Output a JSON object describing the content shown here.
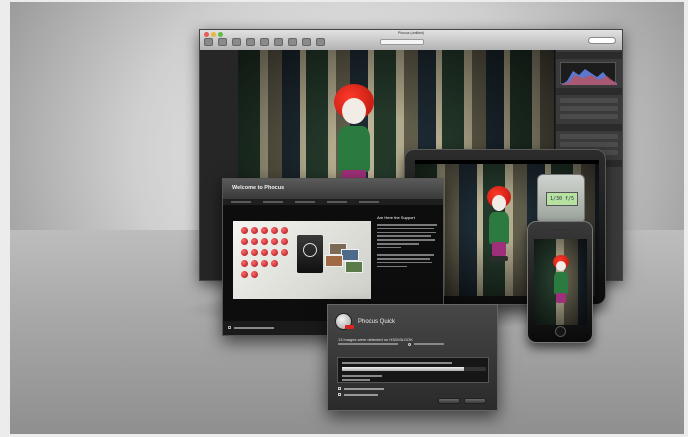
{
  "desktop_window": {
    "title": "Phocus (untitled)"
  },
  "ipad": {
    "lcd_value": "1/30 f/5"
  },
  "welcome_dialog": {
    "title": "Welcome to Phocus",
    "text_heading": "Are Here the Support"
  },
  "quick_dialog": {
    "title": "Phocus Quick",
    "message": "13 images were detected on H3DII3LOOK",
    "progress": 0.85
  },
  "colors": {
    "accent_red": "#d22222",
    "dialog_bg": "#2a2a2a"
  }
}
